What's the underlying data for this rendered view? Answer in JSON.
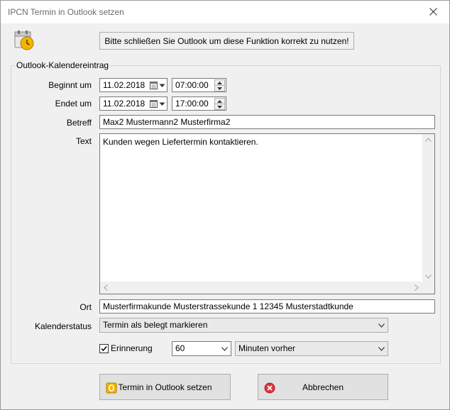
{
  "window": {
    "title": "IPCN Termin in Outlook setzen"
  },
  "notice": "Bitte schließen Sie Outlook um diese Funktion korrekt zu nutzen!",
  "group": {
    "title": "Outlook-Kalendereintrag"
  },
  "fields": {
    "start_label": "Beginnt um",
    "start_date": "11.02.2018",
    "start_time": "07:00:00",
    "end_label": "Endet um",
    "end_date": "11.02.2018",
    "end_time": "17:00:00",
    "subject_label": "Betreff",
    "subject_value": "Max2 Mustermann2 Musterfirma2",
    "text_label": "Text",
    "text_value": "Kunden wegen Liefertermin kontaktieren.",
    "location_label": "Ort",
    "location_value": "Musterfirmakunde Musterstrassekunde 1 12345 Musterstadtkunde",
    "status_label": "Kalenderstatus",
    "status_value": "Termin als belegt markieren",
    "reminder_label": "Erinnerung",
    "reminder_checked": true,
    "reminder_value": "60",
    "reminder_unit": "Minuten vorher"
  },
  "buttons": {
    "ok": "Termin in Outlook setzen",
    "cancel": "Abbrechen"
  },
  "colors": {
    "outlook_yellow": "#f4b400",
    "cancel_red": "#d9363e"
  }
}
